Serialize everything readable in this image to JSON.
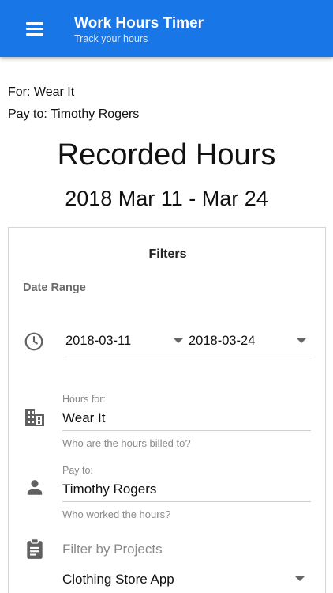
{
  "app_bar": {
    "title": "Work Hours Timer",
    "subtitle": "Track your hours",
    "menu_icon": "menu-icon",
    "color": "#1976e6"
  },
  "header": {
    "for_line": "For: Wear It",
    "pay_line": "Pay to: Timothy Rogers",
    "title": "Recorded Hours",
    "period": "2018 Mar 11 - Mar 24"
  },
  "filters": {
    "title": "Filters",
    "date_range_label": "Date Range",
    "date_icon": "clock-icon",
    "start_date": "2018-03-11",
    "end_date": "2018-03-24",
    "hours_for": {
      "icon": "building-icon",
      "label": "Hours for:",
      "value": "Wear It",
      "helper": "Who are the hours billed to?"
    },
    "pay_to": {
      "icon": "person-icon",
      "label": "Pay to:",
      "value": "Timothy Rogers",
      "helper": "Who worked the hours?"
    },
    "projects": {
      "icon": "clipboard-icon",
      "label": "Filter by Projects",
      "selected": "Clothing Store App"
    }
  }
}
